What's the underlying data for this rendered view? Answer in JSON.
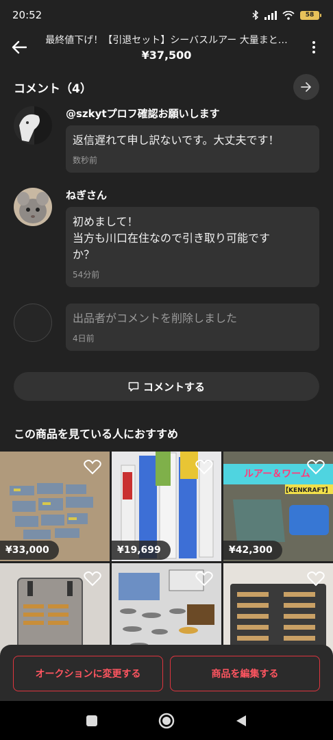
{
  "status": {
    "time": "20:52",
    "battery": "58"
  },
  "header": {
    "title": "最終値下げ！【引退セット】シーバスルアー 大量まと…",
    "price": "¥37,500"
  },
  "comments": {
    "title": "コメント（4）",
    "items": [
      {
        "name": "@szkytプロフ確認お願いします",
        "text": "返信遅れて申し訳ないです。大丈夫です！",
        "time": "数秒前"
      },
      {
        "name": "ねぎさん",
        "text": "初めまして！\n当方も川口在住なので引き取り可能です\nか？",
        "time": "54分前"
      },
      {
        "name": "",
        "text": "出品者がコメントを削除しました",
        "time": "4日前"
      }
    ],
    "comment_button": "コメントする"
  },
  "recommend": {
    "title": "この商品を見ている人におすすめ",
    "items": [
      {
        "price": "¥33,000"
      },
      {
        "price": "¥19,699"
      },
      {
        "price": "¥42,300",
        "banner": "ルアー＆ワーム",
        "sub": "【KENKRAFT】"
      },
      {
        "price": ""
      },
      {
        "price": ""
      },
      {
        "price": ""
      }
    ]
  },
  "actions": {
    "auction": "オークションに変更する",
    "edit": "商品を編集する"
  },
  "colors": {
    "accent": "#e0353f",
    "background": "#222222",
    "surface": "#333333"
  }
}
